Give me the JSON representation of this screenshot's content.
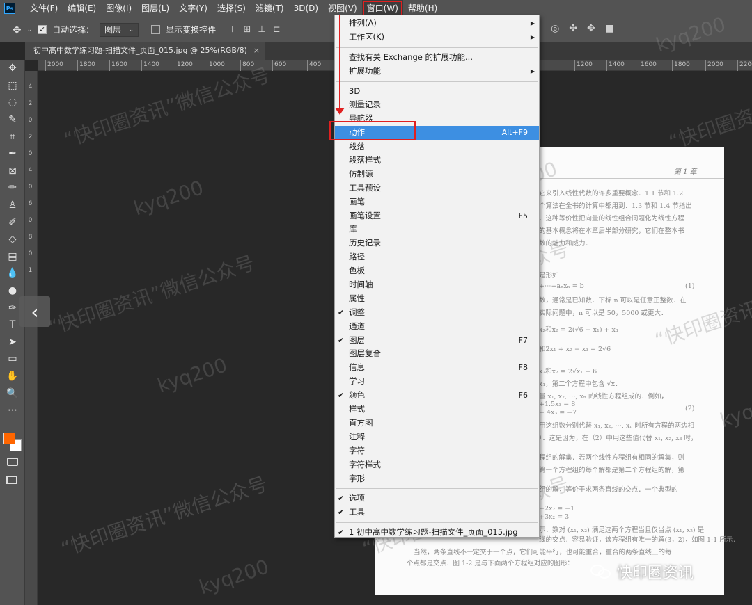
{
  "app": {
    "logo": "Ps"
  },
  "menubar": {
    "items": [
      "文件(F)",
      "编辑(E)",
      "图像(I)",
      "图层(L)",
      "文字(Y)",
      "选择(S)",
      "滤镜(T)",
      "3D(D)",
      "视图(V)",
      "窗口(W)",
      "帮助(H)"
    ],
    "active": "窗口(W)"
  },
  "options": {
    "auto_select_label": "自动选择：",
    "auto_select_checked": true,
    "auto_select_value": "图层",
    "show_transform_label": "显示变换控件",
    "show_transform_checked": false
  },
  "document": {
    "tab_title": "初中高中数学练习题-扫描文件_页面_015.jpg @ 25%(RGB/8)",
    "close_glyph": "×"
  },
  "ruler": {
    "h_ticks": [
      "2000",
      "1800",
      "1600",
      "1400",
      "1200",
      "1000",
      "800",
      "600",
      "400",
      "1200",
      "1400",
      "1600",
      "1800",
      "2000",
      "2200"
    ],
    "v_ticks": [
      "4",
      "2",
      "0",
      "2",
      "0",
      "4",
      "0",
      "6",
      "0",
      "8",
      "0",
      "1"
    ]
  },
  "window_menu": {
    "items": [
      {
        "label": "排列(A)",
        "submenu": true
      },
      {
        "label": "工作区(K)",
        "submenu": true
      },
      {
        "sep": true
      },
      {
        "label": "查找有关 Exchange 的扩展功能..."
      },
      {
        "label": "扩展功能",
        "submenu": true
      },
      {
        "sep": true
      },
      {
        "label": "3D"
      },
      {
        "label": "测量记录"
      },
      {
        "label": "导航器"
      },
      {
        "label": "动作",
        "shortcut": "Alt+F9",
        "highlighted": true
      },
      {
        "label": "段落"
      },
      {
        "label": "段落样式"
      },
      {
        "label": "仿制源"
      },
      {
        "label": "工具预设"
      },
      {
        "label": "画笔"
      },
      {
        "label": "画笔设置",
        "shortcut": "F5"
      },
      {
        "label": "库"
      },
      {
        "label": "历史记录"
      },
      {
        "label": "路径"
      },
      {
        "label": "色板"
      },
      {
        "label": "时间轴"
      },
      {
        "label": "属性"
      },
      {
        "label": "调整",
        "checked": true
      },
      {
        "label": "通道"
      },
      {
        "label": "图层",
        "shortcut": "F7",
        "checked": true
      },
      {
        "label": "图层复合"
      },
      {
        "label": "信息",
        "shortcut": "F8"
      },
      {
        "label": "学习"
      },
      {
        "label": "颜色",
        "shortcut": "F6",
        "checked": true
      },
      {
        "label": "样式"
      },
      {
        "label": "直方图"
      },
      {
        "label": "注释"
      },
      {
        "label": "字符"
      },
      {
        "label": "字符样式"
      },
      {
        "label": "字形"
      },
      {
        "sep": true
      },
      {
        "label": "选项",
        "checked": true
      },
      {
        "label": "工具",
        "checked": true
      },
      {
        "sep": true
      },
      {
        "label": "1 初中高中数学练习题-扫描文件_页面_015.jpg",
        "checked": true
      }
    ]
  },
  "paper": {
    "chapter": "第 1 章",
    "lines": [
      "它来引入线性代数的许多重要概念．1.1 节和 1.2",
      "个算法在全书的计算中都用到．1.3 节和 1.4 节指出",
      "．这种等价性把向量的线性组合问题化为线性方程",
      "的基本概念将在本章后半部分研究，它们在整本书",
      "数的魅力和威力．",
      "是形如",
      "+⋯+aₙxₙ = b",
      "(1)",
      "数，通常是已知数．下标 n 可以是任意正整数．在",
      "实际问题中，n 可以是 50，5000 或更大．",
      "x₂和x₂ = 2(√6 − x₁) + x₃",
      "和2x₁ + x₂ − x₃ = 2√6",
      "x₂和x₂ = 2√x₁ − 6",
      "x₁，第二个方程中包含 √x．",
      "量 x₁, x₂, ⋯, xₙ 的线性方程组成的．例如，",
      "+1.5x₃ =  8",
      "(2)",
      "−  4x₃ = −7",
      "用这组数分别代替 x₁, x₂, ⋯, xₙ 时所有方程的两边相",
      "）．这是因为，在（2）中用这些值代替 x₁, x₂, x₃ 时，",
      "程组的解集．若两个线性方程组有相同的解集，则",
      "第一个方程组的每个解都是第二个方程组的解，第",
      "组的解，等价于求两条直线的交点．一个典型的",
      "−2x₂ = −1",
      "+3x₂ =  3",
      "示．数对 (x₁, x₂) 满足这两个方程当且仅当点 (x₁, x₂) 是",
      "线的交点．容易验证，该方程组有唯一的解(3，2)，如图 1-1 所示．",
      "当然，两条直线不一定交于一个点，它们可能平行，也可能重合，重合的两条直线上的每",
      "个点都是交点．图 1-2 是与下面两个方程组对应的图形："
    ]
  },
  "watermarks": {
    "text_a": "“快印圈资讯”微信公众号",
    "text_b": "kyq200"
  },
  "corner_logo": {
    "text": "快印圈资讯"
  },
  "colors": {
    "foreground": "#ff6600",
    "background": "#ffffff",
    "highlight": "#3d8fe2",
    "annotation": "#e02020"
  },
  "toolbar_icons": [
    "move-icon",
    "marquee-icon",
    "lasso-icon",
    "quick-select-icon",
    "crop-icon",
    "eyedropper-icon",
    "frame-icon",
    "brush-icon",
    "stamp-icon",
    "history-brush-icon",
    "eraser-icon",
    "gradient-icon",
    "blur-icon",
    "dodge-icon",
    "pen-icon",
    "type-icon",
    "path-select-icon",
    "rectangle-icon",
    "hand-icon",
    "zoom-icon",
    "more-icon"
  ]
}
